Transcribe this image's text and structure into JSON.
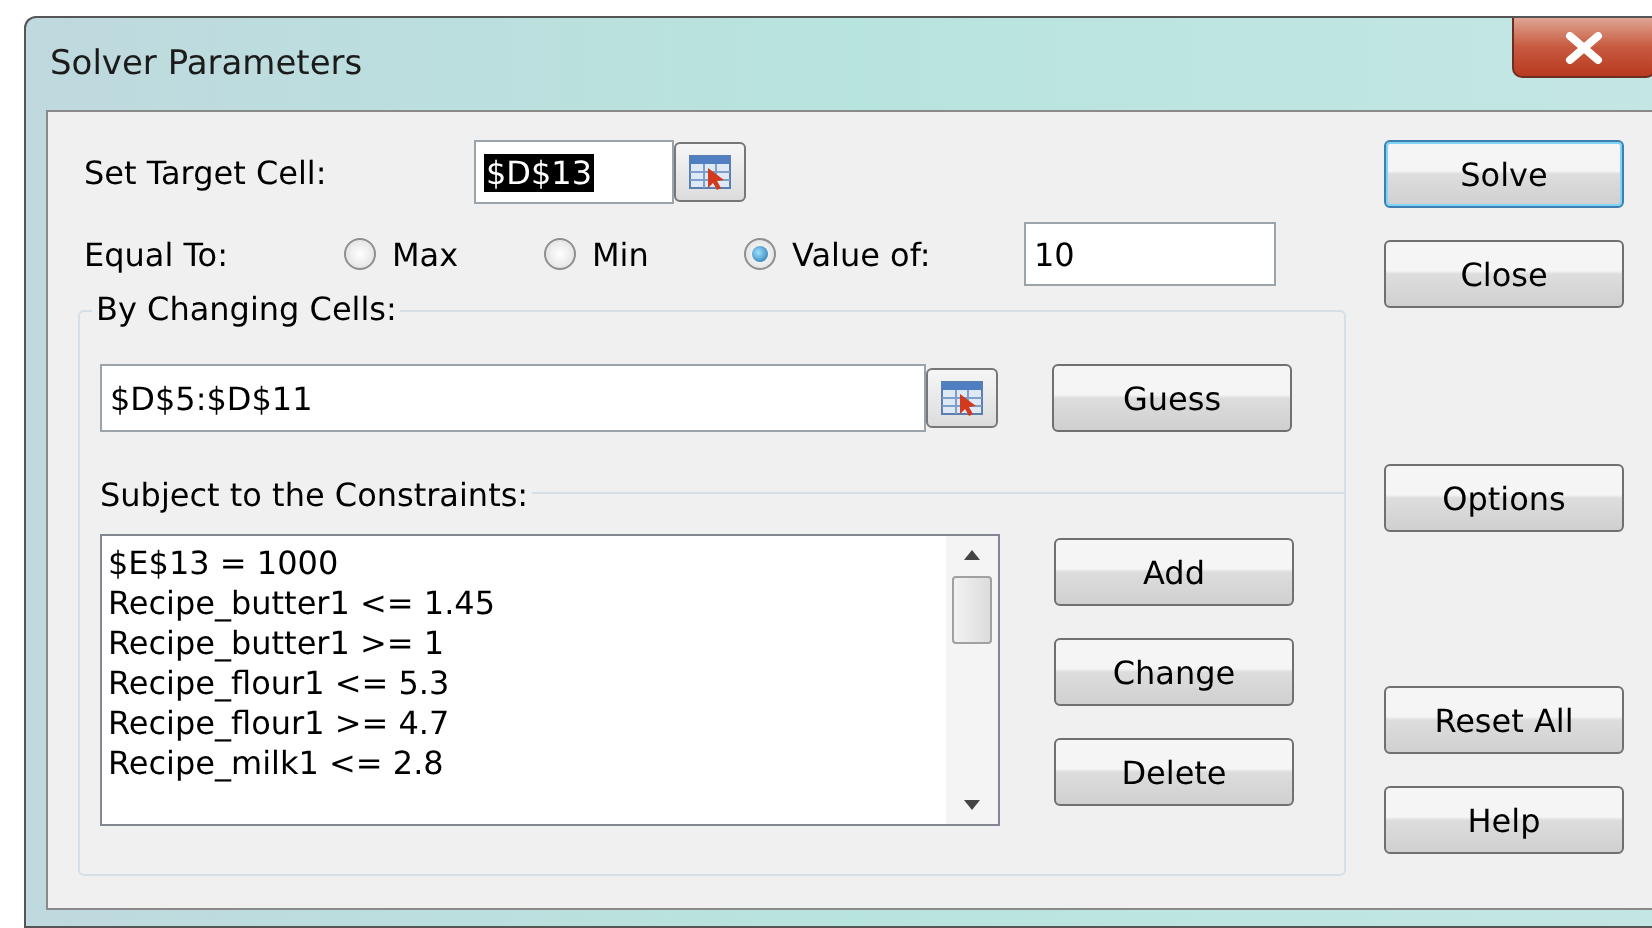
{
  "window": {
    "title": "Solver Parameters"
  },
  "target": {
    "label": "Set Target Cell:",
    "value": "$D$13"
  },
  "equal_to": {
    "label": "Equal To:",
    "options": [
      {
        "label": "Max",
        "selected": false
      },
      {
        "label": "Min",
        "selected": false
      },
      {
        "label": "Value of:",
        "selected": true
      }
    ],
    "value": "10"
  },
  "changing_cells": {
    "label": "By Changing Cells:",
    "value": "$D$5:$D$11",
    "button": "Guess"
  },
  "constraints": {
    "label": "Subject to the Constraints:",
    "items": [
      "$E$13 = 1000",
      "Recipe_butter1 <= 1.45",
      "Recipe_butter1 >= 1",
      "Recipe_flour1 <= 5.3",
      "Recipe_flour1 >= 4.7",
      "Recipe_milk1 <= 2.8"
    ],
    "buttons": [
      "Add",
      "Change",
      "Delete"
    ]
  },
  "side_button_groups": [
    {
      "buttons": [
        {
          "label": "Solve",
          "default": true
        },
        {
          "label": "Close",
          "default": false
        }
      ]
    },
    {
      "buttons": [
        {
          "label": "Options",
          "default": false
        }
      ]
    },
    {
      "buttons": [
        {
          "label": "Reset All",
          "default": false
        },
        {
          "label": "Help",
          "default": false
        }
      ]
    }
  ]
}
